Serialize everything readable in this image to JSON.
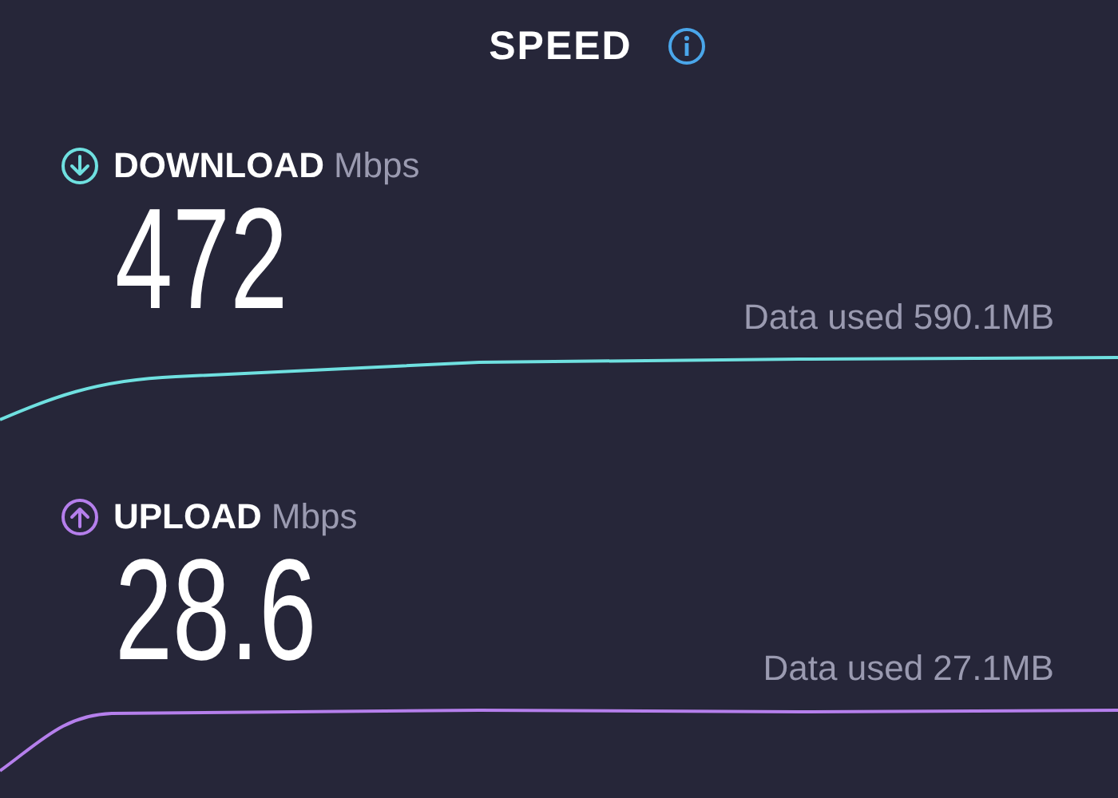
{
  "title": "SPEED",
  "tests": [
    {
      "kind": "download",
      "label": "DOWNLOAD",
      "unit": "Mbps",
      "value": "472",
      "data_used": "Data used 590.1MB",
      "color": "#6fe0e0"
    },
    {
      "kind": "upload",
      "label": "UPLOAD",
      "unit": "Mbps",
      "value": "28.6",
      "data_used": "Data used 27.1MB",
      "color": "#b57fec"
    }
  ]
}
